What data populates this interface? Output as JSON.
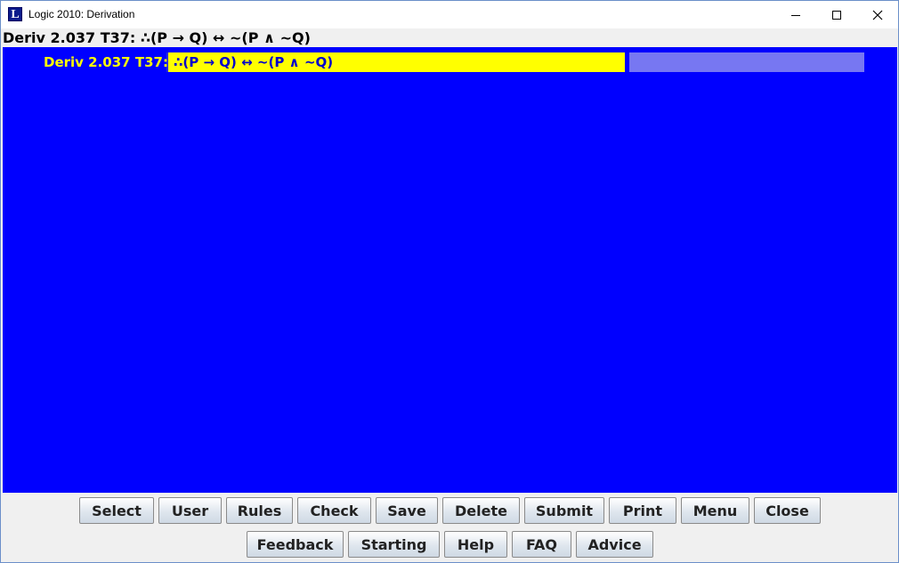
{
  "window": {
    "title": "Logic 2010: Derivation",
    "icon_letter": "L"
  },
  "header": {
    "text": "Deriv 2.037 T37:  ∴(P → Q) ↔ ~(P ∧ ~Q)"
  },
  "derivation": {
    "label": "Deriv 2.037 T37:",
    "formula": "∴(P → Q) ↔ ~(P ∧ ~Q)",
    "justification": ""
  },
  "buttons_row1": {
    "select": "Select",
    "user": "User",
    "rules": "Rules",
    "check": "Check",
    "save": "Save",
    "delete": "Delete",
    "submit": "Submit",
    "print": "Print",
    "menu": "Menu",
    "close": "Close"
  },
  "buttons_row2": {
    "feedback": "Feedback",
    "starting": "Starting",
    "help": "Help",
    "faq": "FAQ",
    "advice": "Advice"
  },
  "colors": {
    "workspace": "#0000ff",
    "formula_bg": "#ffff00",
    "label_text": "#ffff00",
    "formula_text": "#0000cc",
    "justification_bg": "#7777f2"
  }
}
